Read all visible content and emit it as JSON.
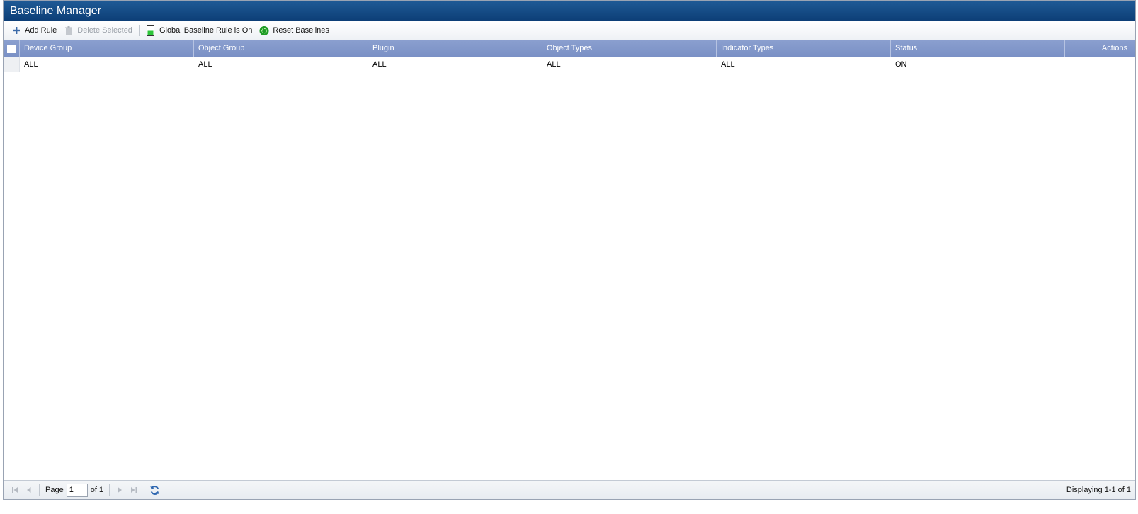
{
  "title": "Baseline Manager",
  "toolbar": {
    "add_rule": "Add Rule",
    "delete_selected": "Delete Selected",
    "global_rule": "Global Baseline Rule is On",
    "reset_baselines": "Reset Baselines"
  },
  "columns": {
    "device_group": "Device Group",
    "object_group": "Object Group",
    "plugin": "Plugin",
    "object_types": "Object Types",
    "indicator_types": "Indicator Types",
    "status": "Status",
    "actions": "Actions"
  },
  "rows": [
    {
      "device_group": "ALL",
      "object_group": "ALL",
      "plugin": "ALL",
      "object_types": "ALL",
      "indicator_types": "ALL",
      "status": "ON",
      "actions": ""
    }
  ],
  "pager": {
    "page_label": "Page",
    "page_value": "1",
    "of_label": "of 1",
    "display_text": "Displaying 1-1 of 1"
  },
  "colors": {
    "title_bar": "#0d3f77",
    "header": "#7a90c5",
    "global_rule_icon": "#2cc53a",
    "reset_icon": "#1e9b24"
  }
}
